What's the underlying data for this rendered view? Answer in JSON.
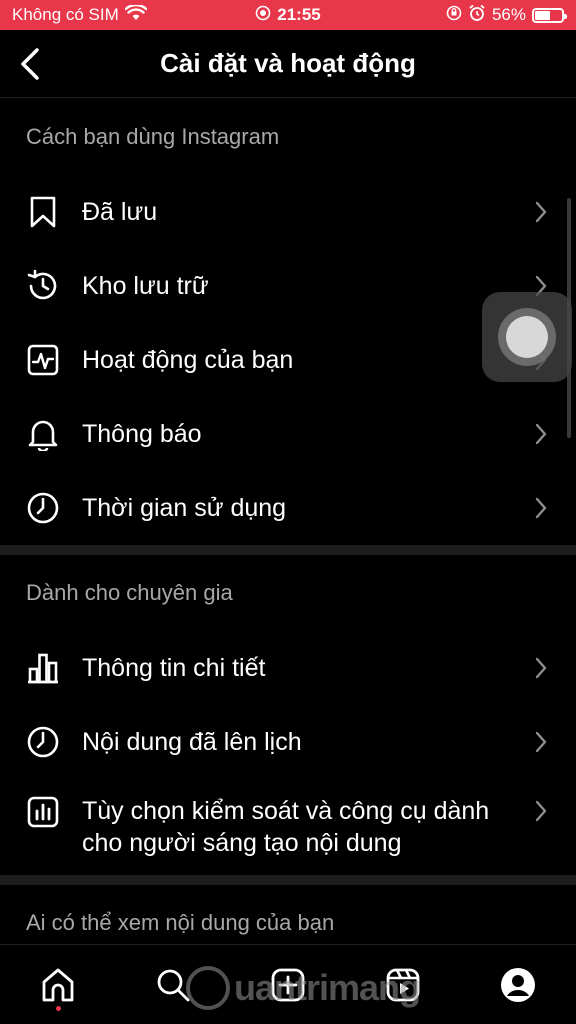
{
  "status_bar": {
    "carrier": "Không có SIM",
    "time": "21:55",
    "battery_text": "56%",
    "battery_level": 0.56
  },
  "header": {
    "title": "Cài đặt và hoạt động"
  },
  "sections": [
    {
      "title": "Cách bạn dùng Instagram",
      "items": [
        {
          "label": "Đã lưu",
          "icon": "bookmark-icon"
        },
        {
          "label": "Kho lưu trữ",
          "icon": "archive-history-icon"
        },
        {
          "label": "Hoạt động của bạn",
          "icon": "activity-icon"
        },
        {
          "label": "Thông báo",
          "icon": "bell-icon"
        },
        {
          "label": "Thời gian sử dụng",
          "icon": "clock-icon"
        }
      ]
    },
    {
      "title": "Dành cho chuyên gia",
      "items": [
        {
          "label": "Thông tin chi tiết",
          "icon": "bar-chart-icon"
        },
        {
          "label": "Nội dung đã lên lịch",
          "icon": "clock-icon"
        },
        {
          "label": "Tùy chọn kiểm soát và công cụ dành cho người sáng tạo nội dung",
          "icon": "creator-tools-icon"
        }
      ]
    },
    {
      "title": "Ai có thể xem nội dung của bạn"
    }
  ],
  "bottom_nav": [
    "home-icon",
    "search-icon",
    "new-post-icon",
    "reels-icon",
    "profile-icon"
  ],
  "watermark": "uantrimang",
  "colors": {
    "accent": "#e8374a",
    "background": "#000000",
    "muted": "#a8a8a8"
  }
}
